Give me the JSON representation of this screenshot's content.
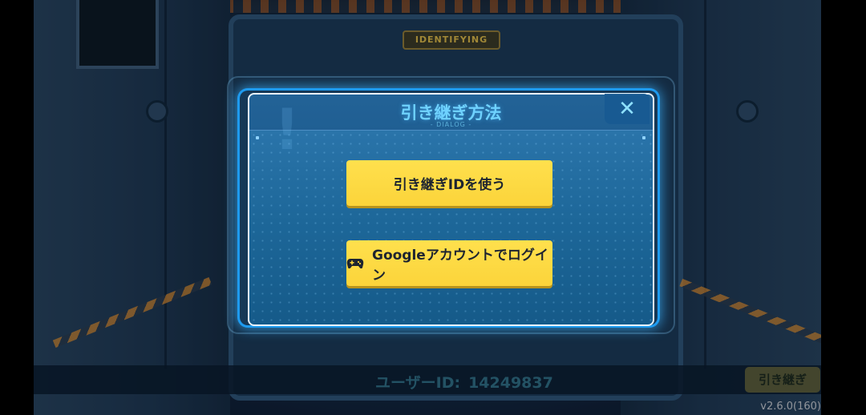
{
  "background": {
    "sign_text": "IDENTIFYING"
  },
  "footer": {
    "user_id_label": "ユーザーID:",
    "user_id_value": "14249837",
    "transfer_button": "引き継ぎ",
    "version": "v2.6.0(160)"
  },
  "dialog": {
    "title": "引き継ぎ方法",
    "subtitle": "- DIALOG -",
    "close_symbol": "✕",
    "buttons": {
      "use_id": "引き継ぎIDを使う",
      "google_login": "Googleアカウントでログイン"
    }
  },
  "colors": {
    "accent_blue": "#1e9bf0",
    "button_yellow": "#fbd43a",
    "title_cyan": "#6fd2ff"
  },
  "icons": {
    "google_login": "gamepad-icon",
    "close": "close-icon"
  }
}
